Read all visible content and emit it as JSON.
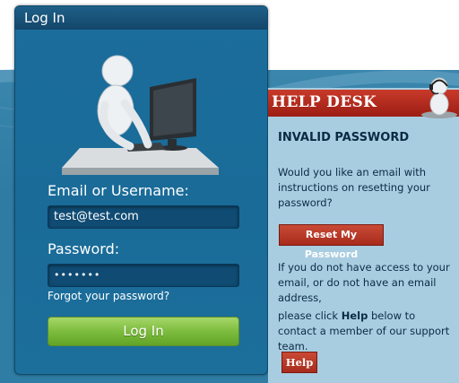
{
  "login": {
    "title": "Log In",
    "username_label": "Email or Username:",
    "username_value": "test@test.com",
    "password_label": "Password:",
    "password_value": "•••••••",
    "forgot_label": "Forgot your password?",
    "submit_label": "Log In"
  },
  "helpdesk": {
    "banner_title": "HELP DESK",
    "heading": "INVALID PASSWORD",
    "reset_prompt": "Would you like an email with instructions on resetting your password?",
    "reset_button": "Reset My Password",
    "no_access_text": "If you do not have access to your email, or do not have an email address,",
    "contact_prefix": "please click ",
    "contact_bold": "Help",
    "contact_suffix": " below to contact a member of our support team.",
    "help_button": "Help"
  },
  "colors": {
    "panel_blue": "#1b6d9c",
    "login_green": "#7cbc3d",
    "help_red": "#a72b1c",
    "help_bg": "#a9cde0"
  },
  "icons": [
    "person-at-computer-icon",
    "headset-support-icon"
  ]
}
